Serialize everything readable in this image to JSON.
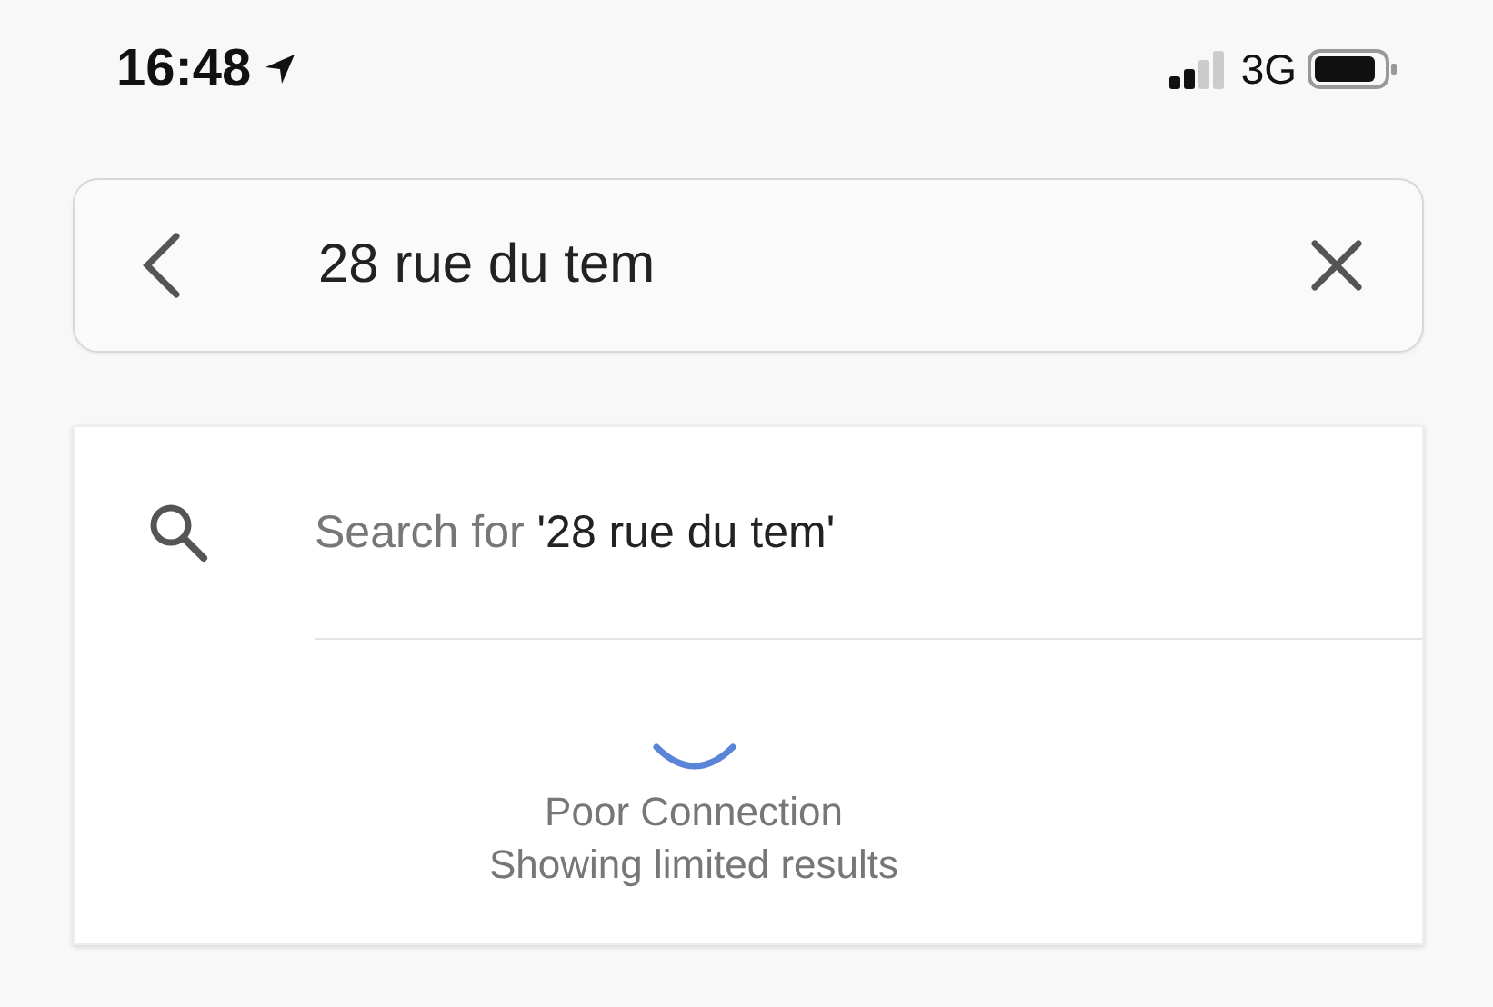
{
  "status_bar": {
    "time": "16:48",
    "network": "3G"
  },
  "search": {
    "value": "28 rue du tem"
  },
  "suggestion": {
    "prefix": "Search for ",
    "query": "'28 rue du tem'"
  },
  "notice": {
    "title": "Poor Connection",
    "subtitle": "Showing limited results"
  }
}
